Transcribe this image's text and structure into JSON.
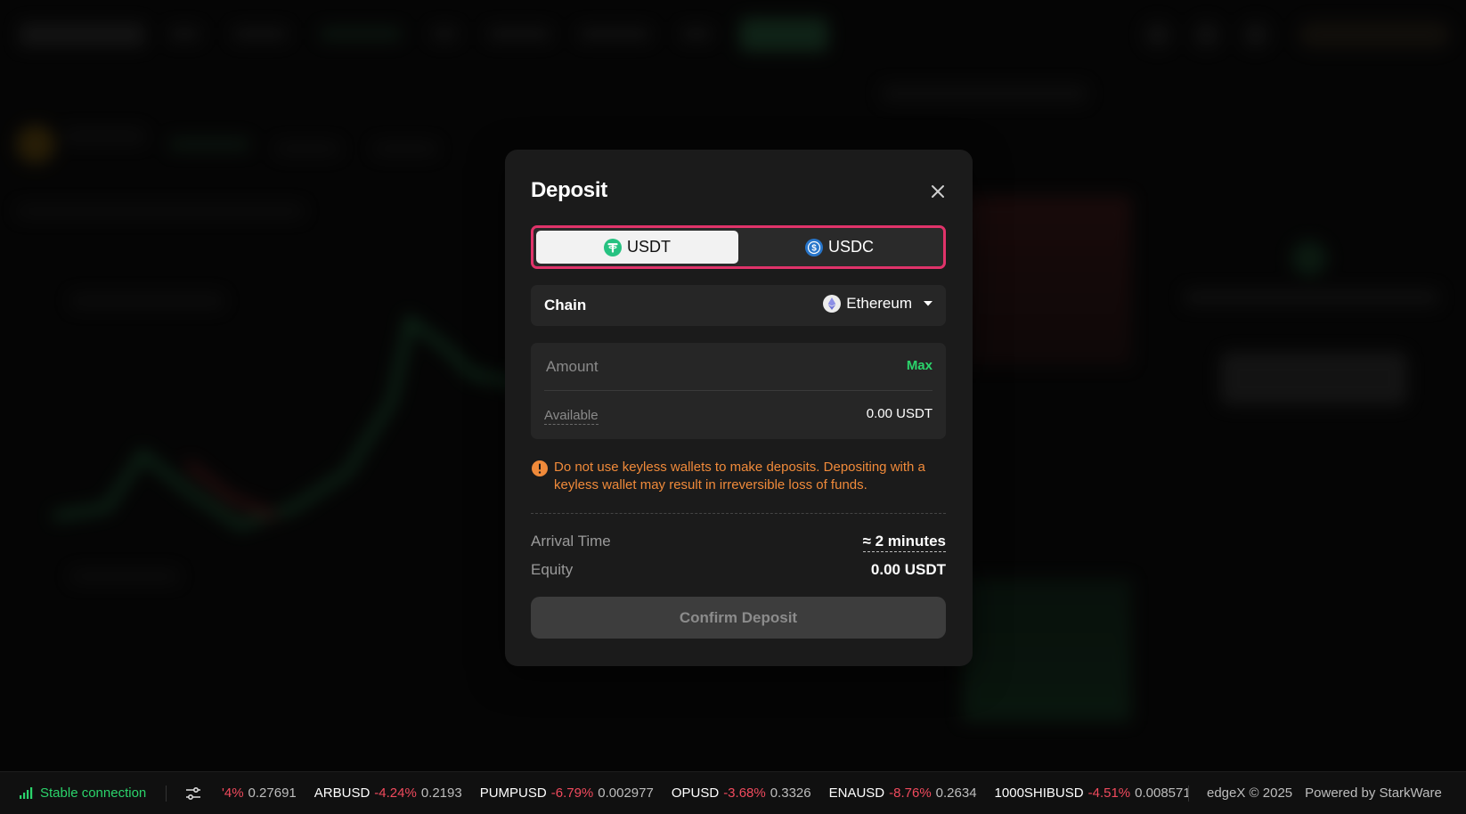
{
  "modal": {
    "title": "Deposit",
    "tokens": [
      "USDT",
      "USDC"
    ],
    "active_token": "USDT",
    "chain": {
      "label": "Chain",
      "value": "Ethereum"
    },
    "amount": {
      "placeholder": "Amount",
      "max_label": "Max",
      "available_label": "Available",
      "available_value": "0.00 USDT"
    },
    "warning": "Do not use keyless wallets to make deposits. Depositing with a keyless wallet may result in irreversible loss of funds.",
    "arrival": {
      "label": "Arrival Time",
      "value": "≈ 2 minutes"
    },
    "equity": {
      "label": "Equity",
      "value": "0.00 USDT"
    },
    "confirm_label": "Confirm Deposit"
  },
  "statusbar": {
    "connection": "Stable connection",
    "ticker": [
      {
        "symbol": "",
        "change": "'4%",
        "price": "0.27691"
      },
      {
        "symbol": "ARBUSD",
        "change": "-4.24%",
        "price": "0.2193"
      },
      {
        "symbol": "PUMPUSD",
        "change": "-6.79%",
        "price": "0.002977"
      },
      {
        "symbol": "OPUSD",
        "change": "-3.68%",
        "price": "0.3326"
      },
      {
        "symbol": "ENAUSD",
        "change": "-8.76%",
        "price": "0.2634"
      },
      {
        "symbol": "1000SHIBUSD",
        "change": "-4.51%",
        "price": "0.008571"
      },
      {
        "symbol": "1(",
        "change": "",
        "price": ""
      }
    ],
    "copyright": "edgeX © 2025",
    "powered_by": "Powered by StarkWare"
  },
  "colors": {
    "accent_green": "#2bd46b",
    "negative_red": "#f04a5d",
    "warning_orange": "#f08a3a",
    "toggle_highlight": "#e0336a",
    "usdt_green": "#26c281",
    "usdc_blue": "#2775ca"
  },
  "icons": [
    "close-icon",
    "usdt-icon",
    "usdc-icon",
    "ethereum-icon",
    "chevron-down-icon",
    "warning-icon",
    "signal-icon",
    "filter-icon"
  ]
}
